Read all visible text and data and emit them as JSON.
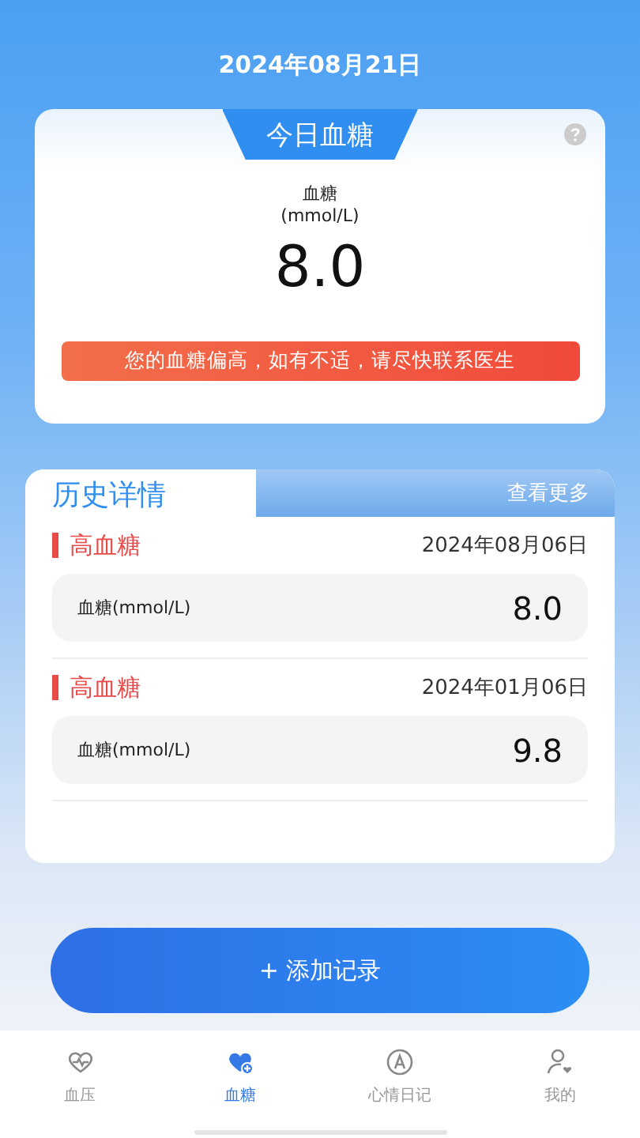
{
  "header": {
    "date": "2024年08月21日"
  },
  "today_card": {
    "tab": "今日血糖",
    "label": "血糖",
    "unit": "(mmol/L)",
    "value": "8.0",
    "warning": "您的血糖偏高，如有不适，请尽快联系医生"
  },
  "history": {
    "title": "历史详情",
    "more": "查看更多",
    "records": [
      {
        "status": "高血糖",
        "color": "#e84a4a",
        "date": "2024年08月06日",
        "label": "血糖(mmol/L)",
        "value": "8.0"
      },
      {
        "status": "高血糖",
        "color": "#e84a4a",
        "date": "2024年01月06日",
        "label": "血糖(mmol/L)",
        "value": "9.8"
      }
    ]
  },
  "add_button": {
    "label": "+ 添加记录"
  },
  "tab_bar": [
    {
      "label": "血压",
      "selected": false
    },
    {
      "label": "血糖",
      "selected": true
    },
    {
      "label": "心情日记",
      "selected": false
    },
    {
      "label": "我的",
      "selected": false
    }
  ]
}
